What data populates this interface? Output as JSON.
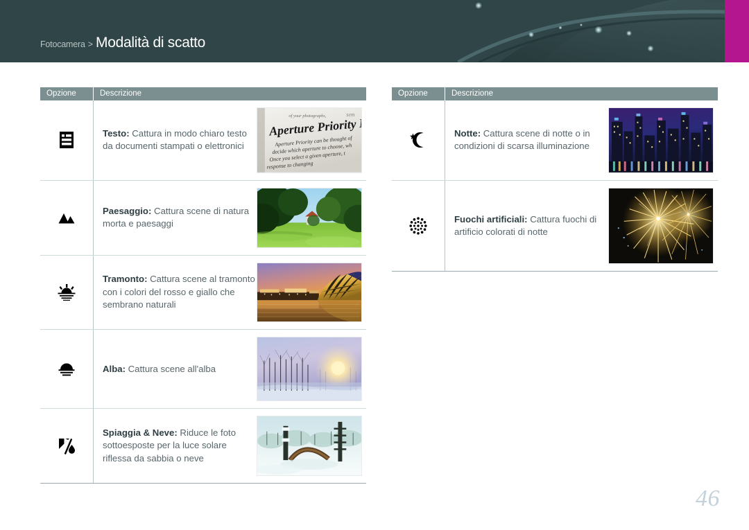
{
  "header": {
    "breadcrumb_parent": "Fotocamera",
    "breadcrumb_separator": ">",
    "breadcrumb_current": "Modalità di scatto",
    "bg_color": "#2f4547",
    "accent_color": "#b3168e"
  },
  "table_headers": {
    "option": "Opzione",
    "description": "Descrizione",
    "bg_color": "#7b8f90"
  },
  "left_table": {
    "rows": [
      {
        "icon": "text-document-icon",
        "title": "Testo",
        "separator": ":",
        "description": " Cattura in modo chiaro testo da documenti stampati o elettronici",
        "thumb": "printed-page-aperture-priority-photo"
      },
      {
        "icon": "mountain-icon",
        "title": "Paesaggio",
        "separator": ":",
        "description": " Cattura scene di natura morta e paesaggi",
        "thumb": "green-park-landscape-photo"
      },
      {
        "icon": "sunset-icon",
        "title": "Tramonto",
        "separator": ":",
        "description": " Cattura scene al tramonto con i colori del rosso e giallo che sembrano naturali",
        "thumb": "sunset-lake-building-photo"
      },
      {
        "icon": "sunrise-icon",
        "title": "Alba",
        "separator": ":",
        "description": " Cattura scene all'alba",
        "thumb": "misty-sunrise-winter-photo"
      },
      {
        "icon": "beach-snow-icon",
        "title": "Spiaggia & Neve",
        "separator": ":",
        "description": " Riduce le foto sottoesposte per la luce solare riflessa da sabbia o neve",
        "thumb": "snowy-park-bench-photo"
      }
    ]
  },
  "right_table": {
    "rows": [
      {
        "icon": "moon-star-icon",
        "title": "Notte",
        "separator": ":",
        "description": " Cattura scene di notte o in condizioni di scarsa illuminazione",
        "thumb": "night-city-skyline-photo"
      },
      {
        "icon": "fireworks-icon",
        "title": "Fuochi artificiali",
        "separator": ":",
        "description": " Cattura fuochi di artificio colorati di notte",
        "thumb": "golden-fireworks-photo"
      }
    ]
  },
  "footer": {
    "page_number": "46"
  }
}
